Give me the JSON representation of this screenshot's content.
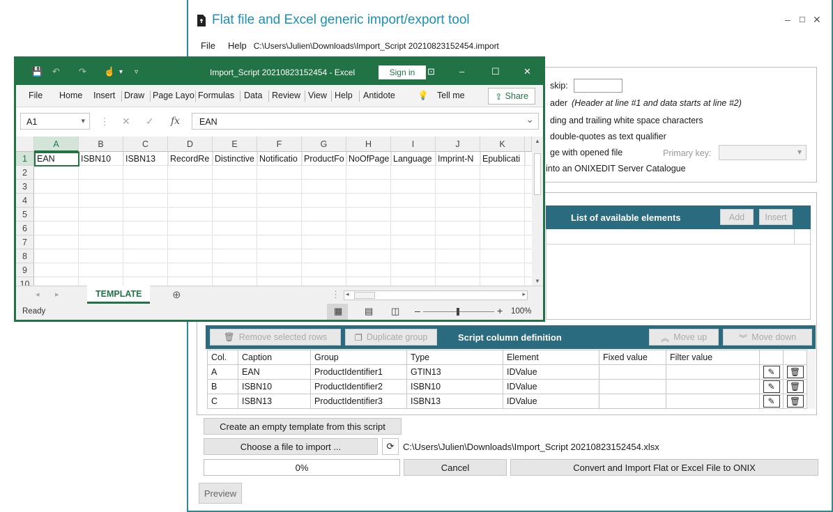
{
  "tool": {
    "title": "Flat file and Excel generic import/export tool",
    "menu": [
      "File",
      "Help"
    ],
    "file_path": "C:\\Users\\Julien\\Downloads\\Import_Script 20210823152454.import",
    "options": {
      "skip_label": "skip:",
      "header_partial": "ader",
      "header_note": "(Header at line #1 and data starts at line #2)",
      "trim_partial": "ding and trailing white space characters",
      "quotes_partial": "double-quotes as text qualifier",
      "merge_partial": "ge with opened file",
      "primary_key_label": "Primary key:",
      "server_partial": "into an ONIXEDIT Server Catalogue"
    },
    "available": {
      "title": "List of available elements",
      "add": "Add",
      "insert": "Insert"
    },
    "script": {
      "title": "Script column definition",
      "remove": "Remove selected rows",
      "duplicate": "Duplicate group",
      "move_up": "Move up",
      "move_down": "Move down",
      "headers": [
        "Col.",
        "Caption",
        "Group",
        "Type",
        "Element",
        "Fixed value",
        "Filter value"
      ],
      "rows": [
        [
          "A",
          "EAN",
          "ProductIdentifier1",
          "GTIN13",
          "IDValue",
          "",
          ""
        ],
        [
          "B",
          "ISBN10",
          "ProductIdentifier2",
          "ISBN10",
          "IDValue",
          "",
          ""
        ],
        [
          "C",
          "ISBN13",
          "ProductIdentifier3",
          "ISBN13",
          "IDValue",
          "",
          ""
        ]
      ]
    },
    "create_template": "Create an empty template from this script",
    "choose_file": "Choose a file to import ...",
    "import_path": "C:\\Users\\Julien\\Downloads\\Import_Script 20210823152454.xlsx",
    "progress": "0%",
    "cancel": "Cancel",
    "convert": "Convert and Import Flat or Excel File to ONIX",
    "preview": "Preview"
  },
  "excel": {
    "title": "Import_Script 20210823152454  -  Excel",
    "sign_in": "Sign in",
    "ribbon": [
      "File",
      "Home",
      "Insert",
      "Draw",
      "Page Layo",
      "Formulas",
      "Data",
      "Review",
      "View",
      "Help",
      "Antidote"
    ],
    "tell_me": "Tell me",
    "share": "Share",
    "name_box": "A1",
    "fx": "fx",
    "formula": "EAN",
    "columns": [
      "A",
      "B",
      "C",
      "D",
      "E",
      "F",
      "G",
      "H",
      "I",
      "J",
      "K"
    ],
    "rows": [
      "1",
      "2",
      "3",
      "4",
      "5",
      "6",
      "7",
      "8",
      "9",
      "10"
    ],
    "row1": [
      "EAN",
      "ISBN10",
      "ISBN13",
      "RecordRe",
      "Distinctive",
      "Notificatio",
      "ProductFo",
      "NoOfPage",
      "Language",
      "Imprint-N",
      "Epublicati"
    ],
    "sheet_tab": "TEMPLATE",
    "status": "Ready",
    "zoom": "100%"
  }
}
